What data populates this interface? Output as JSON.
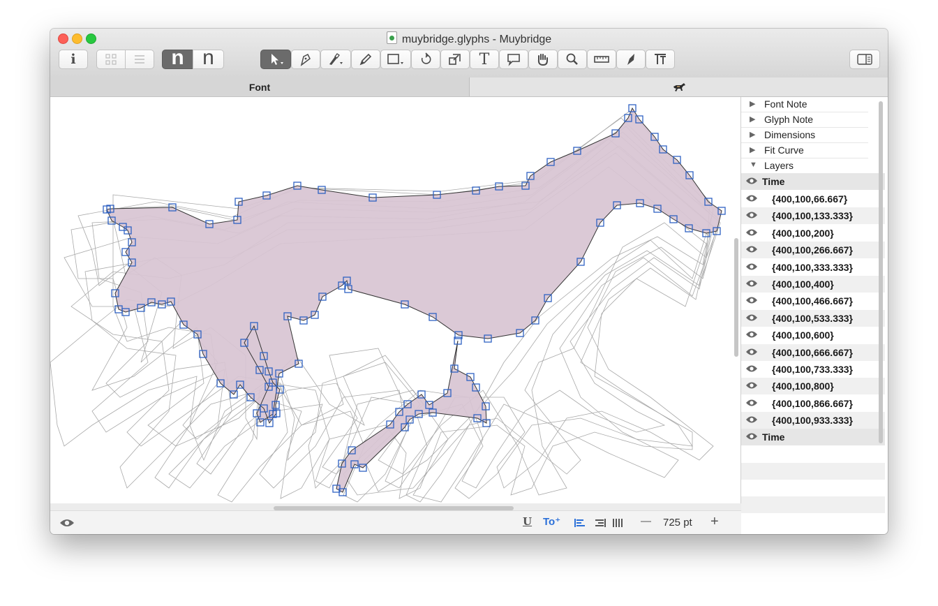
{
  "window": {
    "title": "muybridge.glyphs - Muybridge"
  },
  "toolbar": {
    "info_label": "i",
    "n_dark_label": "n",
    "n_light_label": "n",
    "text_tool_label": "T"
  },
  "tabs": {
    "font_label": "Font",
    "glyph_tab_icon": "horse-icon"
  },
  "bottom_bar": {
    "zoom_label": "725 pt",
    "minus_label": "—",
    "plus_label": "+"
  },
  "panel": {
    "sections": [
      {
        "label": "Font Note",
        "expanded": false
      },
      {
        "label": "Glyph Note",
        "expanded": false
      },
      {
        "label": "Dimensions",
        "expanded": false
      },
      {
        "label": "Fit Curve",
        "expanded": false
      },
      {
        "label": "Layers",
        "expanded": true
      }
    ],
    "layer_group_top": "Time",
    "layers": [
      "{400,100,66.667}",
      "{400,100,133.333}",
      "{400,100,200}",
      "{400,100,266.667}",
      "{400,100,333.333}",
      "{400,100,400}",
      "{400,100,466.667}",
      "{400,100,533.333}",
      "{400,100,600}",
      "{400,100,666.667}",
      "{400,100,733.333}",
      "{400,100,800}",
      "{400,100,866.667}",
      "{400,100,933.333}"
    ],
    "layer_group_bottom": "Time"
  },
  "colors": {
    "glyph_fill": "#d8c4d3",
    "node_stroke": "#2f62c2",
    "outline_gray": "#a8a8a8"
  }
}
